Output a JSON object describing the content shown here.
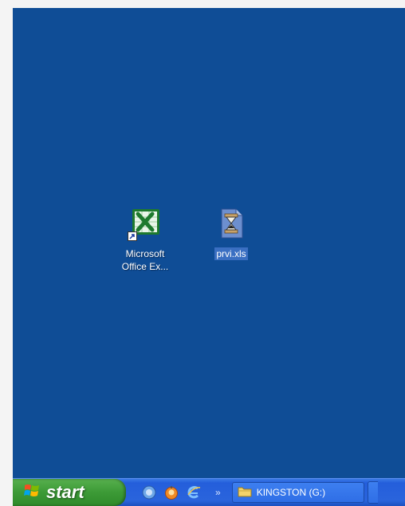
{
  "desktop": {
    "icons": [
      {
        "label": "Microsoft\nOffice Ex...",
        "icon": "excel-shortcut-icon",
        "selected": false
      },
      {
        "label": "prvi.xls",
        "icon": "excel-file-hourglass-icon",
        "selected": true
      }
    ]
  },
  "taskbar": {
    "start_label": "start",
    "quick_launch": [
      "ie-icon",
      "firefox-icon",
      "internet-explorer-icon"
    ],
    "overflow": "»",
    "task_button_label": "KINGSTON (G:)"
  },
  "colors": {
    "desktop": "#0f4d96",
    "taskbar": "#245edb",
    "start": "#3c9a36"
  }
}
